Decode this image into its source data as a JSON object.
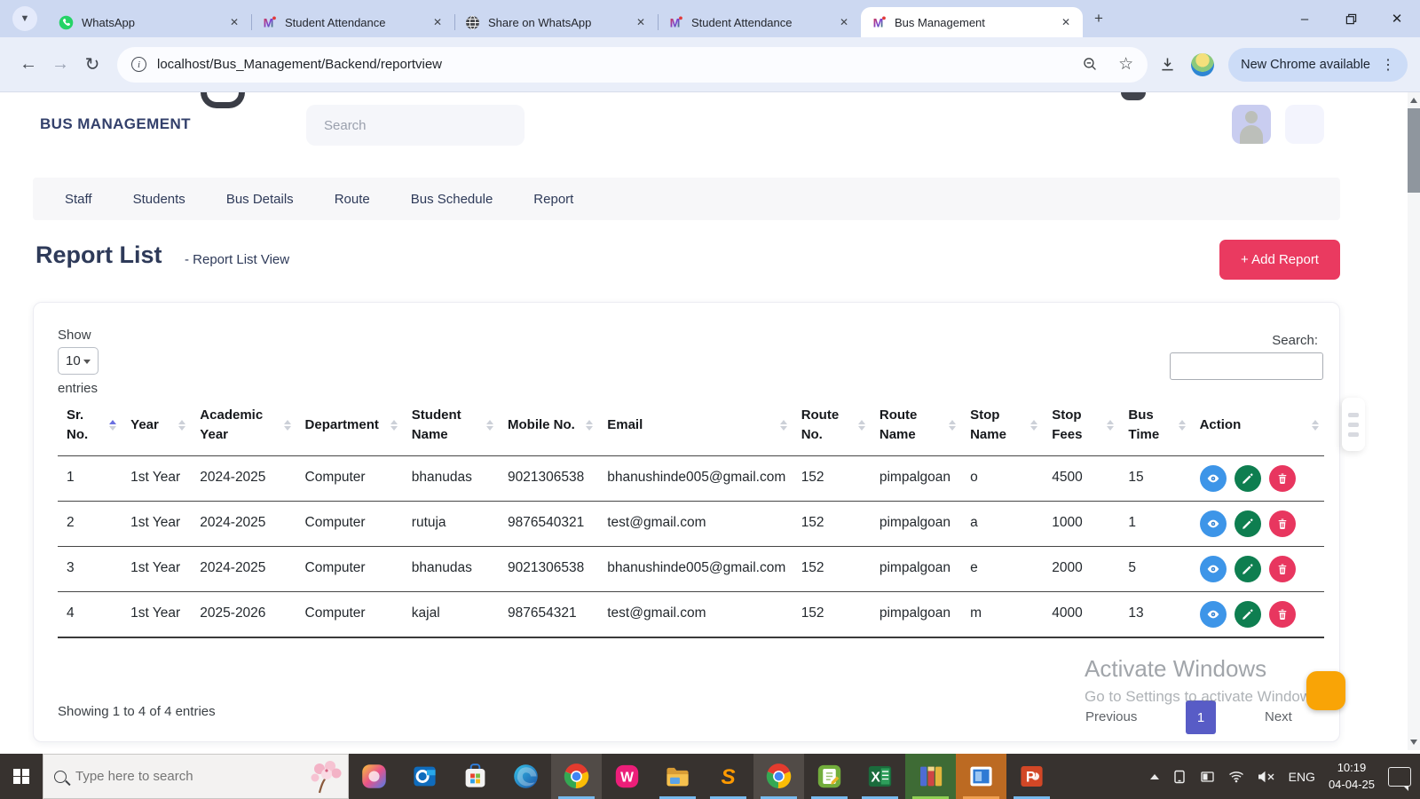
{
  "browser": {
    "tabs": [
      {
        "label": "WhatsApp",
        "icon": "whatsapp",
        "active": false
      },
      {
        "label": "Student Attendance",
        "icon": "m-logo",
        "active": false
      },
      {
        "label": "Share on WhatsApp",
        "icon": "globe",
        "active": false
      },
      {
        "label": "Student Attendance",
        "icon": "m-logo",
        "active": false
      },
      {
        "label": "Bus Management",
        "icon": "m-logo",
        "active": true
      }
    ],
    "url": "localhost/Bus_Management/Backend/reportview",
    "update_button": "New Chrome available"
  },
  "page": {
    "brand": "BUS MANAGEMENT",
    "header_search_placeholder": "Search",
    "nav_items": [
      "Staff",
      "Students",
      "Bus Details",
      "Route",
      "Bus Schedule",
      "Report"
    ],
    "title": "Report List",
    "subtitle": "-  Report List View",
    "add_report_label": "+ Add Report",
    "datatable": {
      "show_label": "Show",
      "page_size": "10",
      "entries_label": "entries",
      "search_label": "Search:",
      "search_value": "",
      "columns": [
        "Sr. No.",
        "Year",
        "Academic Year",
        "Department",
        "Student Name",
        "Mobile No.",
        "Email",
        "Route No.",
        "Route Name",
        "Stop Name",
        "Stop Fees",
        "Bus Time",
        "Action"
      ],
      "sorted_column": "Sr. No.",
      "sort_direction": "asc",
      "rows": [
        {
          "sr": "1",
          "year": "1st Year",
          "academic_year": "2024-2025",
          "department": "Computer",
          "student_name": "bhanudas",
          "mobile": "9021306538",
          "email": "bhanushinde005@gmail.com",
          "route_no": "152",
          "route_name": "pimpalgoan",
          "stop_name": "o",
          "stop_fees": "4500",
          "bus_time": "15"
        },
        {
          "sr": "2",
          "year": "1st Year",
          "academic_year": "2024-2025",
          "department": "Computer",
          "student_name": "rutuja",
          "mobile": "9876540321",
          "email": "test@gmail.com",
          "route_no": "152",
          "route_name": "pimpalgoan",
          "stop_name": "a",
          "stop_fees": "1000",
          "bus_time": "1"
        },
        {
          "sr": "3",
          "year": "1st Year",
          "academic_year": "2024-2025",
          "department": "Computer",
          "student_name": "bhanudas",
          "mobile": "9021306538",
          "email": "bhanushinde005@gmail.com",
          "route_no": "152",
          "route_name": "pimpalgoan",
          "stop_name": "e",
          "stop_fees": "2000",
          "bus_time": "5"
        },
        {
          "sr": "4",
          "year": "1st Year",
          "academic_year": "2025-2026",
          "department": "Computer",
          "student_name": "kajal",
          "mobile": "987654321",
          "email": "test@gmail.com",
          "route_no": "152",
          "route_name": "pimpalgoan",
          "stop_name": "m",
          "stop_fees": "4000",
          "bus_time": "13"
        }
      ],
      "summary": "Showing 1 to 4 of 4 entries",
      "pagination": {
        "previous": "Previous",
        "current": "1",
        "next": "Next"
      }
    }
  },
  "watermark": {
    "line1": "Activate Windows",
    "line2": "Go to Settings to activate Windows."
  },
  "taskbar": {
    "search_placeholder": "Type here to search",
    "apps": [
      {
        "name": "copilot"
      },
      {
        "name": "outlook"
      },
      {
        "name": "store"
      },
      {
        "name": "edge"
      },
      {
        "name": "chrome",
        "highlight": "gray",
        "underline": true
      },
      {
        "name": "wamp"
      },
      {
        "name": "file-explorer",
        "underline": true
      },
      {
        "name": "sublime-text",
        "underline": true
      },
      {
        "name": "chrome",
        "highlight": "gray",
        "underline": true
      },
      {
        "name": "notepad",
        "underline": true
      },
      {
        "name": "excel",
        "underline": true
      },
      {
        "name": "winrar",
        "highlight": "green",
        "underline": true
      },
      {
        "name": "windows-app",
        "highlight": "orange",
        "underline": true
      },
      {
        "name": "powerpoint",
        "underline": true
      }
    ],
    "language": "ENG",
    "time": "10:19",
    "date": "04-04-25"
  },
  "colors": {
    "accent_pink": "#ea3a60",
    "navy": "#2e3a59",
    "action_view": "#3d95e8",
    "action_edit": "#0e7e50",
    "action_delete": "#e8365f",
    "pagination_active": "#585cc6",
    "chat_bubble": "#f9a406",
    "tabstrip": "#ccd8f1",
    "taskbar": "#37322f"
  }
}
